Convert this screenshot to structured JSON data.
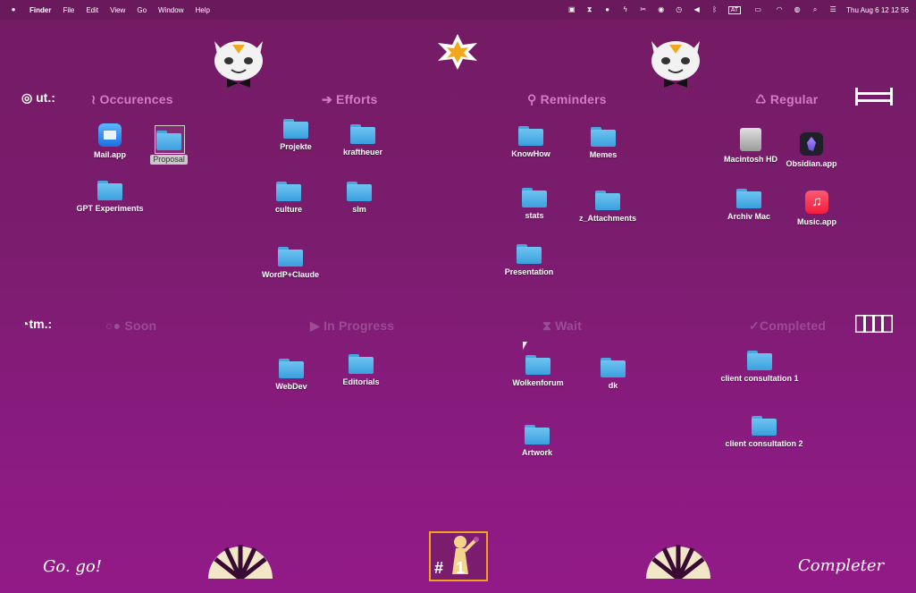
{
  "menubar": {
    "app": "Finder",
    "menus": [
      "File",
      "Edit",
      "View",
      "Go",
      "Window",
      "Help"
    ],
    "input_source": "AT",
    "clock": "Thu Aug 6  12 12 56"
  },
  "rows": {
    "top": {
      "label": "ut.:"
    },
    "bottom": {
      "label": "tm.:"
    }
  },
  "sections": {
    "occurences": "Occurences",
    "efforts": "Efforts",
    "reminders": "Reminders",
    "regular": "Regular",
    "soon": "Soon",
    "in_progress": "In Progress",
    "wait": "Wait",
    "completed": "Completed"
  },
  "icons": {
    "mail": "Mail.app",
    "proposal": "Proposal",
    "gpt": "GPT Experiments",
    "projekte": "Projekte",
    "kraftheuer": "kraftheuer",
    "culture": "culture",
    "slm": "slm",
    "wordp": "WordP+Claude",
    "knowhow": "KnowHow",
    "memes": "Memes",
    "stats": "stats",
    "z_attach": "z_Attachments",
    "presentation": "Presentation",
    "macintosh": "Macintosh HD",
    "obsidian": "Obsidian.app",
    "archiv": "Archiv Mac",
    "music": "Music.app",
    "webdev": "WebDev",
    "editorials": "Editorials",
    "wolkenforum": "Wolkenforum",
    "dk": "dk",
    "artwork": "Artwork",
    "client1": "client consultation 1",
    "client2": "client consultation 2"
  },
  "footer": {
    "left": "Go. go!",
    "right": "Completer",
    "badge": "#1"
  },
  "colors": {
    "accent": "#d47bc4",
    "folder": "#4aa6df",
    "badge_border": "#f0a21a"
  }
}
